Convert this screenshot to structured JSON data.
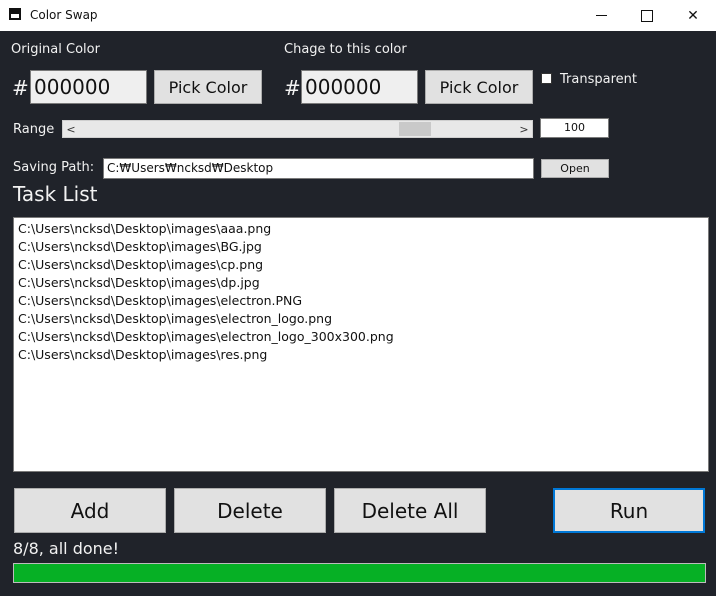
{
  "window": {
    "title": "Color Swap",
    "icons": {
      "app": "app-window-icon",
      "minimize": "minimize-icon",
      "maximize": "maximize-icon",
      "close": "close-icon"
    },
    "close_glyph": "✕"
  },
  "original": {
    "label": "Original Color",
    "hash": "#",
    "value": "000000",
    "pick_label": "Pick Color"
  },
  "target": {
    "label": "Chage to this color",
    "hash": "#",
    "value": "000000",
    "pick_label": "Pick Color",
    "transparent_label": "Transparent",
    "transparent_checked": false
  },
  "range": {
    "label": "Range",
    "value": "100",
    "left_arrow": "<",
    "right_arrow": ">"
  },
  "saving": {
    "label": "Saving Path:",
    "path": "C:₩Users₩ncksd₩Desktop",
    "open_label": "Open"
  },
  "tasks": {
    "title": "Task List",
    "items": [
      "C:\\Users\\ncksd\\Desktop\\images\\aaa.png",
      "C:\\Users\\ncksd\\Desktop\\images\\BG.jpg",
      "C:\\Users\\ncksd\\Desktop\\images\\cp.png",
      "C:\\Users\\ncksd\\Desktop\\images\\dp.jpg",
      "C:\\Users\\ncksd\\Desktop\\images\\electron.PNG",
      "C:\\Users\\ncksd\\Desktop\\images\\electron_logo.png",
      "C:\\Users\\ncksd\\Desktop\\images\\electron_logo_300x300.png",
      "C:\\Users\\ncksd\\Desktop\\images\\res.png"
    ]
  },
  "actions": {
    "add": "Add",
    "delete": "Delete",
    "delete_all": "Delete All",
    "run": "Run"
  },
  "status": {
    "text": "8/8, all done!",
    "progress_fraction": 1.0
  },
  "colors": {
    "background": "#20232a",
    "progress": "#06b025",
    "run_border": "#0078d7"
  }
}
